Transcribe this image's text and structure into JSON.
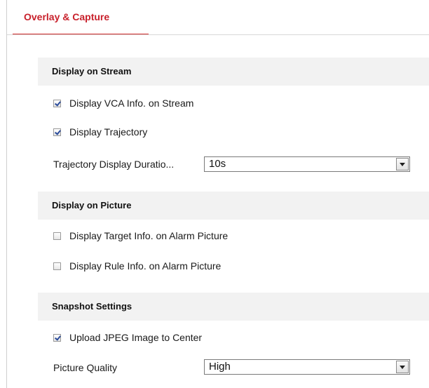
{
  "tab": {
    "label": "Overlay & Capture"
  },
  "sections": {
    "stream": {
      "title": "Display on Stream",
      "vca_label": "Display VCA Info. on Stream",
      "vca_checked": true,
      "trajectory_label": "Display Trajectory",
      "trajectory_checked": true,
      "duration_label": "Trajectory Display Duratio...",
      "duration_value": "10s"
    },
    "picture": {
      "title": "Display on Picture",
      "target_label": "Display Target Info. on Alarm Picture",
      "target_checked": false,
      "rule_label": "Display Rule Info. on Alarm Picture",
      "rule_checked": false
    },
    "snapshot": {
      "title": "Snapshot Settings",
      "upload_label": "Upload JPEG Image to Center",
      "upload_checked": true,
      "quality_label": "Picture Quality",
      "quality_value": "High"
    }
  },
  "colors": {
    "accent": "#c8202b",
    "header_bg": "#f2f2f2"
  }
}
